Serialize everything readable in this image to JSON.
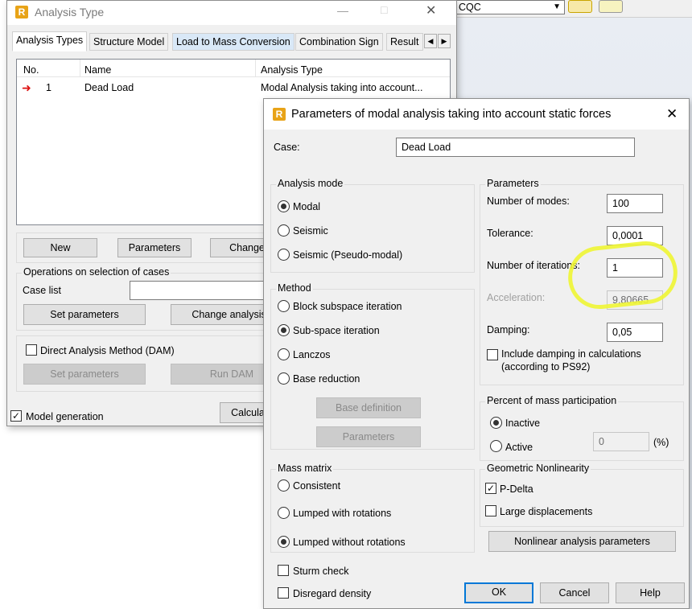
{
  "toolbar": {
    "combo_value": "CQC"
  },
  "analysis_window": {
    "title": "Analysis Type",
    "tabs": [
      "Analysis Types",
      "Structure Model",
      "Load to Mass Conversion",
      "Combination Sign",
      "Result"
    ],
    "table": {
      "headers": [
        "No.",
        "Name",
        "Analysis Type"
      ],
      "rows": [
        {
          "no": "1",
          "name": "Dead Load",
          "type": "Modal Analysis taking into account..."
        }
      ]
    },
    "buttons": {
      "new": "New",
      "parameters": "Parameters",
      "change": "Change"
    },
    "operations": {
      "title": "Operations on selection of cases",
      "case_list_label": "Case list",
      "set_parameters": "Set parameters",
      "change_analysis": "Change analysis t"
    },
    "dam": {
      "label": "Direct Analysis Method (DAM)",
      "set_parameters": "Set parameters",
      "run_dam": "Run DAM"
    },
    "model_generation": "Model generation",
    "calculate": "Calcula"
  },
  "dialog": {
    "title": "Parameters of modal analysis taking into account static forces",
    "case_label": "Case:",
    "case_value": "Dead Load",
    "analysis_mode": {
      "title": "Analysis mode",
      "options": [
        "Modal",
        "Seismic",
        "Seismic (Pseudo-modal)"
      ],
      "selected": 0
    },
    "method": {
      "title": "Method",
      "options": [
        "Block subspace iteration",
        "Sub-space iteration",
        "Lanczos",
        "Base reduction"
      ],
      "selected": 1,
      "base_definition": "Base definition",
      "parameters": "Parameters"
    },
    "mass_matrix": {
      "title": "Mass matrix",
      "options": [
        "Consistent",
        "Lumped with rotations",
        "Lumped without rotations"
      ],
      "selected": 2
    },
    "sturm_check": "Sturm check",
    "disregard_density": "Disregard density",
    "parameters": {
      "title": "Parameters",
      "modes_label": "Number of modes:",
      "modes_value": "100",
      "tolerance_label": "Tolerance:",
      "tolerance_value": "0,0001",
      "iterations_label": "Number of iterations:",
      "iterations_value": "1",
      "acceleration_label": "Acceleration:",
      "acceleration_value": "9,80665",
      "damping_label": "Damping:",
      "damping_value": "0,05",
      "include_damping_1": "Include damping in calculations",
      "include_damping_2": "(according to PS92)"
    },
    "mass_participation": {
      "title": "Percent of mass participation",
      "inactive": "Inactive",
      "active": "Active",
      "value": "0",
      "unit": "(%)"
    },
    "geometric_nonlinearity": {
      "title": "Geometric Nonlinearity",
      "pdelta": "P-Delta",
      "large_displacements": "Large displacements",
      "nonlinear_button": "Nonlinear analysis parameters"
    },
    "buttons": {
      "ok": "OK",
      "cancel": "Cancel",
      "help": "Help"
    },
    "highlight_color": "#eef533"
  }
}
